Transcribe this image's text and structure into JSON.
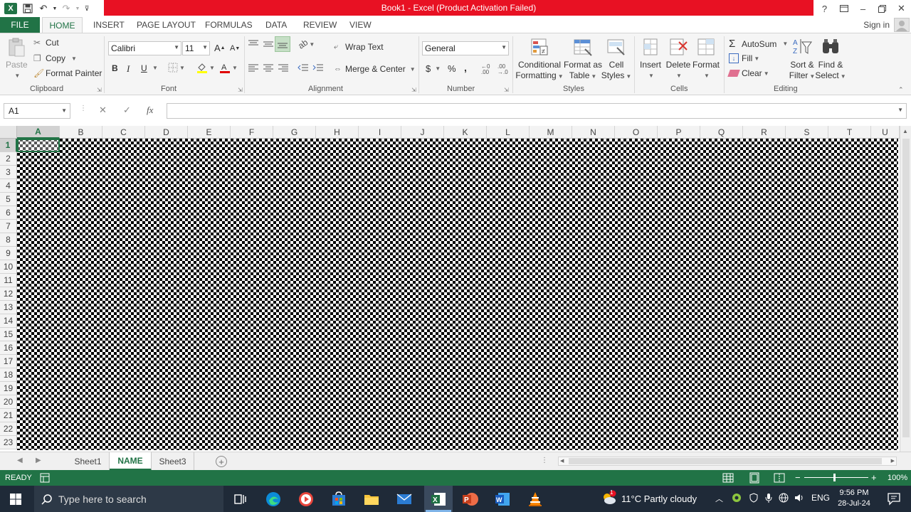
{
  "window": {
    "title": "Book1 - Excel (Product Activation Failed)",
    "title_bar_color": "#e81123",
    "help": "?",
    "controls": [
      "help-icon",
      "ribbon-display-icon",
      "minimize-icon",
      "restore-icon",
      "close-icon"
    ]
  },
  "tabs": [
    "FILE",
    "HOME",
    "INSERT",
    "PAGE LAYOUT",
    "FORMULAS",
    "DATA",
    "REVIEW",
    "VIEW"
  ],
  "signin": "Sign in",
  "accent": "#217346",
  "ribbon": {
    "clipboard": {
      "paste": "Paste",
      "cut": "Cut",
      "copy": "Copy",
      "format_painter": "Format Painter",
      "label": "Clipboard"
    },
    "font": {
      "name": "Calibri",
      "size": "11",
      "label": "Font",
      "grow": "A",
      "shrink": "A",
      "bold": "B",
      "italic": "I",
      "underline": "U"
    },
    "alignment": {
      "wrap_text": "Wrap Text",
      "merge_center": "Merge & Center",
      "label": "Alignment"
    },
    "number": {
      "format": "General",
      "label": "Number",
      "currency": "$",
      "percent": "%",
      "comma": ","
    },
    "styles": {
      "conditional_1": "Conditional",
      "conditional_2": "Formatting",
      "format_table_1": "Format as",
      "format_table_2": "Table",
      "cell_styles_1": "Cell",
      "cell_styles_2": "Styles",
      "label": "Styles"
    },
    "cells": {
      "insert": "Insert",
      "delete": "Delete",
      "format": "Format",
      "label": "Cells"
    },
    "editing": {
      "autosum": "AutoSum",
      "fill": "Fill",
      "clear": "Clear",
      "sort_1": "Sort &",
      "sort_2": "Filter",
      "find_1": "Find &",
      "find_2": "Select",
      "label": "Editing"
    }
  },
  "formula_bar": {
    "name_box": "A1",
    "fx": "fx",
    "value": ""
  },
  "grid": {
    "columns": [
      "A",
      "B",
      "C",
      "D",
      "E",
      "F",
      "G",
      "H",
      "I",
      "J",
      "K",
      "L",
      "M",
      "N",
      "O",
      "P",
      "Q",
      "R",
      "S",
      "T",
      "U"
    ],
    "rows": [
      "1",
      "2",
      "3",
      "4",
      "5",
      "6",
      "7",
      "8",
      "9",
      "10",
      "11",
      "12",
      "13",
      "14",
      "15",
      "16",
      "17",
      "18",
      "19",
      "20",
      "21",
      "22",
      "23"
    ],
    "selected_cell": "A1",
    "fill_pattern": "black-white checker"
  },
  "sheets": [
    "Sheet1",
    "NAME",
    "Sheet3"
  ],
  "active_sheet": "NAME",
  "status": {
    "mode": "READY",
    "zoom": "100%",
    "zoom_minus": "−",
    "zoom_plus": "+"
  },
  "taskbar": {
    "search_placeholder": "Type here to search",
    "apps": [
      "task-view-icon",
      "edge-icon",
      "media-player-icon",
      "store-icon",
      "file-explorer-icon",
      "mail-icon",
      "excel-icon",
      "powerpoint-icon",
      "word-icon",
      "vlc-icon"
    ],
    "weather": "11°C  Partly cloudy",
    "weather_badge": "1",
    "language": "ENG",
    "time": "9:56 PM",
    "date": "28-Jul-24"
  }
}
